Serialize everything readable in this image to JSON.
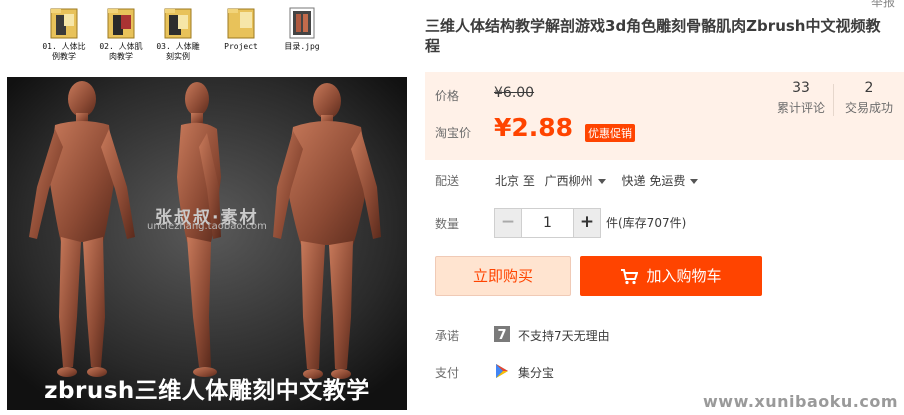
{
  "file_browser": {
    "items": [
      {
        "name": "01. 人体比\n例教学",
        "icon": "folder-icon"
      },
      {
        "name": "02. 人体肌\n肉教学",
        "icon": "folder-icon"
      },
      {
        "name": "03. 人体雕\n刻实例",
        "icon": "folder-icon"
      },
      {
        "name": "Project",
        "icon": "folder-icon"
      },
      {
        "name": "目录.jpg",
        "icon": "image-file-icon"
      }
    ]
  },
  "photo": {
    "watermark_cn": "张叔叔·素材",
    "watermark_en": "unclezhang.taobao.com",
    "banner": "zbrush三维人体雕刻中文教学"
  },
  "top_link": "举报",
  "product": {
    "title": "三维人体结构教学解剖游戏3d角色雕刻骨骼肌肉Zbrush中文视频教程"
  },
  "price": {
    "label": "价格",
    "original": "¥6.00",
    "promo_label": "淘宝价",
    "current": "¥2.88",
    "promo_tag": "优惠促销"
  },
  "stats": {
    "reviews_count": "33",
    "reviews_label": "累计评论",
    "sales_count": "2",
    "sales_label": "交易成功"
  },
  "shipping": {
    "label": "配送",
    "from": "北京 至",
    "to": "广西柳州",
    "method": "快递 免运费"
  },
  "quantity": {
    "label": "数量",
    "value": "1",
    "minus": "−",
    "plus": "+",
    "stock": "件(库存707件)"
  },
  "actions": {
    "buy_now": "立即购买",
    "add_to_cart": "加入购物车"
  },
  "promise": {
    "label": "承诺",
    "text": "不支持7天无理由",
    "icon": "seven-days-icon"
  },
  "payment": {
    "label": "支付",
    "text": "集分宝",
    "icon": "play-triangle-icon"
  },
  "site_watermark": "www.xunibaoku.com",
  "colors": {
    "accent": "#ff4400",
    "price_box_bg": "#fff1e8",
    "buy_now_bg": "#ffe4d0"
  }
}
